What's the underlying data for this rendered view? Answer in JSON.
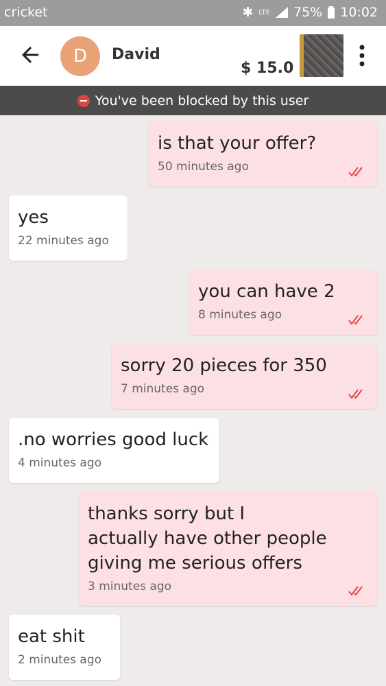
{
  "status_bar": {
    "carrier": "cricket",
    "network": "LTE",
    "battery": "75%",
    "time": "10:02"
  },
  "header": {
    "avatar_letter": "D",
    "contact_name": "David",
    "price": "$ 15.0",
    "avatar_color": "#e8a276"
  },
  "banner": {
    "text": "You've been blocked by this user"
  },
  "messages": [
    {
      "direction": "outgoing",
      "text": "is that your offer?",
      "time": "50 minutes ago",
      "read": true
    },
    {
      "direction": "incoming",
      "text": "yes",
      "time": "22 minutes ago"
    },
    {
      "direction": "outgoing",
      "text": "you can have 2",
      "time": "8 minutes ago",
      "read": true
    },
    {
      "direction": "outgoing",
      "text": "sorry 20 pieces for 350",
      "time": "7 minutes ago",
      "read": true
    },
    {
      "direction": "incoming",
      "text": ".no worries good luck",
      "time": "4 minutes ago"
    },
    {
      "direction": "outgoing",
      "text": "thanks sorry but I\nactually have other people\ngiving me serious offers",
      "time": "3 minutes ago",
      "read": true
    },
    {
      "direction": "incoming",
      "text": "eat shit",
      "time": "2 minutes ago"
    }
  ],
  "colors": {
    "outgoing_bubble": "#fde0e3",
    "incoming_bubble": "#ffffff",
    "read_ticks": "#e0474c",
    "banner_bg": "#4b4b4b"
  }
}
